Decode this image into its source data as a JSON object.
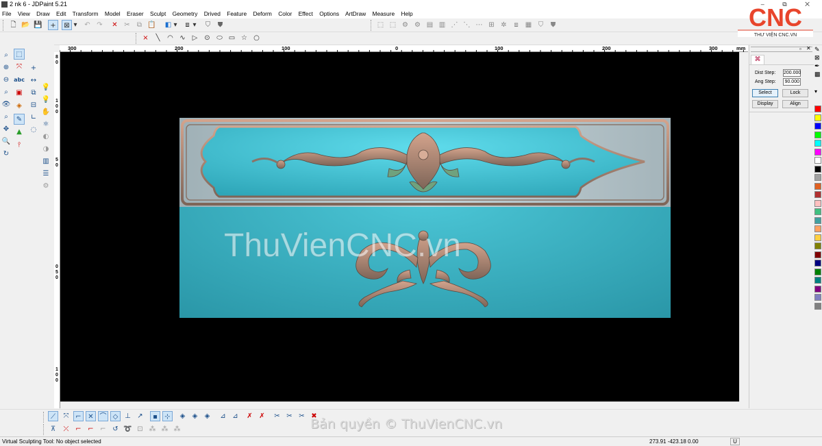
{
  "window": {
    "title": "2 nk 6 - JDPaint 5.21",
    "controls": "– ⧉ ✕"
  },
  "menu": [
    "File",
    "View",
    "Draw",
    "Edit",
    "Transform",
    "Model",
    "Eraser",
    "Sculpt",
    "Geometry",
    "Drived",
    "Feature",
    "Deform",
    "Color",
    "Effect",
    "Options",
    "ArtDraw",
    "Measure",
    "Help"
  ],
  "ruler": {
    "h_ticks": [
      {
        "label": "300",
        "at": 0.03
      },
      {
        "label": "200",
        "at": 0.17
      },
      {
        "label": "100",
        "at": 0.325
      },
      {
        "label": "0",
        "at": 0.49
      },
      {
        "label": "100",
        "at": 0.645
      },
      {
        "label": "200",
        "at": 0.8
      },
      {
        "label": "300",
        "at": 0.955
      }
    ],
    "unit": "mm",
    "v_labels": [
      "8",
      "0",
      "1",
      "0",
      "0",
      "5",
      "0",
      "0",
      "5",
      "0",
      "1",
      "0",
      "0",
      "1",
      "5",
      "0"
    ]
  },
  "right_panel": {
    "dist_step_label": "Dist Step:",
    "dist_step_value": "200.000",
    "ang_step_label": "Ang Step:",
    "ang_step_value": "90.000",
    "select_label": "Select",
    "lock_label": "Lock",
    "display_label": "Display",
    "align_label": "Align"
  },
  "palette": [
    "#ff0000",
    "#ffff00",
    "#0000ff",
    "#00ff00",
    "#00ffff",
    "#ff00ff",
    "#ffffff",
    "#000000",
    "#a0a0a0",
    "#e06020",
    "#b03030",
    "#ffc0c0",
    "#40c080",
    "#40a0a0",
    "#ffa060",
    "#ffd040",
    "#808000",
    "#800000",
    "#000080",
    "#008000",
    "#008080",
    "#800080",
    "#8080c0",
    "#808080"
  ],
  "artwork": {
    "watermark": "ThuVienCNC.vn",
    "copyright": "Bản quyền © ThuVienCNC.vn"
  },
  "logo": {
    "text": "CNC",
    "caption": "THƯ VIỆN CNC.VN",
    "color": "#e8452c"
  },
  "status": {
    "message": "Virtual Sculpting Tool: No object selected",
    "coords": "273.91  -423.18  0.00",
    "indicator": "U"
  }
}
